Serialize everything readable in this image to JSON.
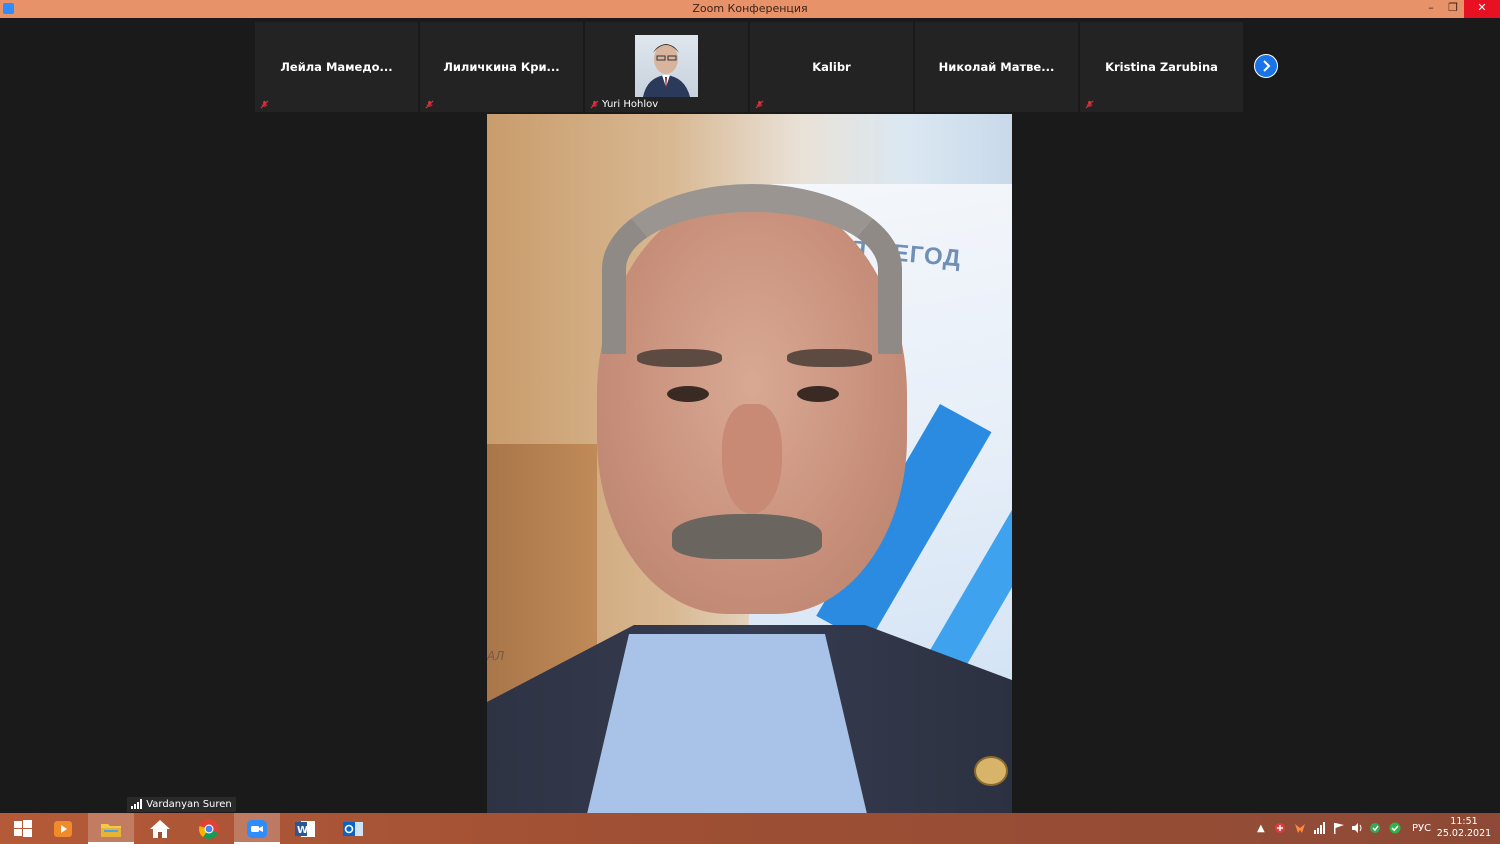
{
  "window": {
    "title": "Zoom Конференция",
    "minimize_glyph": "–",
    "restore_glyph": "❐",
    "close_glyph": "✕"
  },
  "participants": [
    {
      "name": "Лейла  Мамедо...",
      "muted": true
    },
    {
      "name": "Лиличкина  Кри...",
      "muted": true
    },
    {
      "name": "Yuri Hohlov",
      "muted": true,
      "has_video": true
    },
    {
      "name": "Kalibr",
      "muted": true
    },
    {
      "name": "Николай  Матве...",
      "muted": false
    },
    {
      "name": "Kristina Zarubina",
      "muted": true
    }
  ],
  "next_page_icon": "chevron-right-icon",
  "main_video": {
    "poster_text": "СИЯ   СЕГОД",
    "corner_text": "АЛ",
    "speaker_name": "Vardanyan Suren"
  },
  "taskbar": {
    "items": [
      "windows-start-icon",
      "media-player-icon",
      "file-explorer-icon",
      "home-icon",
      "chrome-icon",
      "zoom-icon",
      "word-icon",
      "outlook-icon"
    ],
    "language": "РУС",
    "time": "11:51",
    "date": "25.02.2021",
    "tray_chevron": "▲"
  },
  "colors": {
    "titlebar": "#e8926a",
    "taskbar": "#a8553a",
    "zoom_blue": "#2d8cff",
    "mute_red": "#e0303a"
  }
}
